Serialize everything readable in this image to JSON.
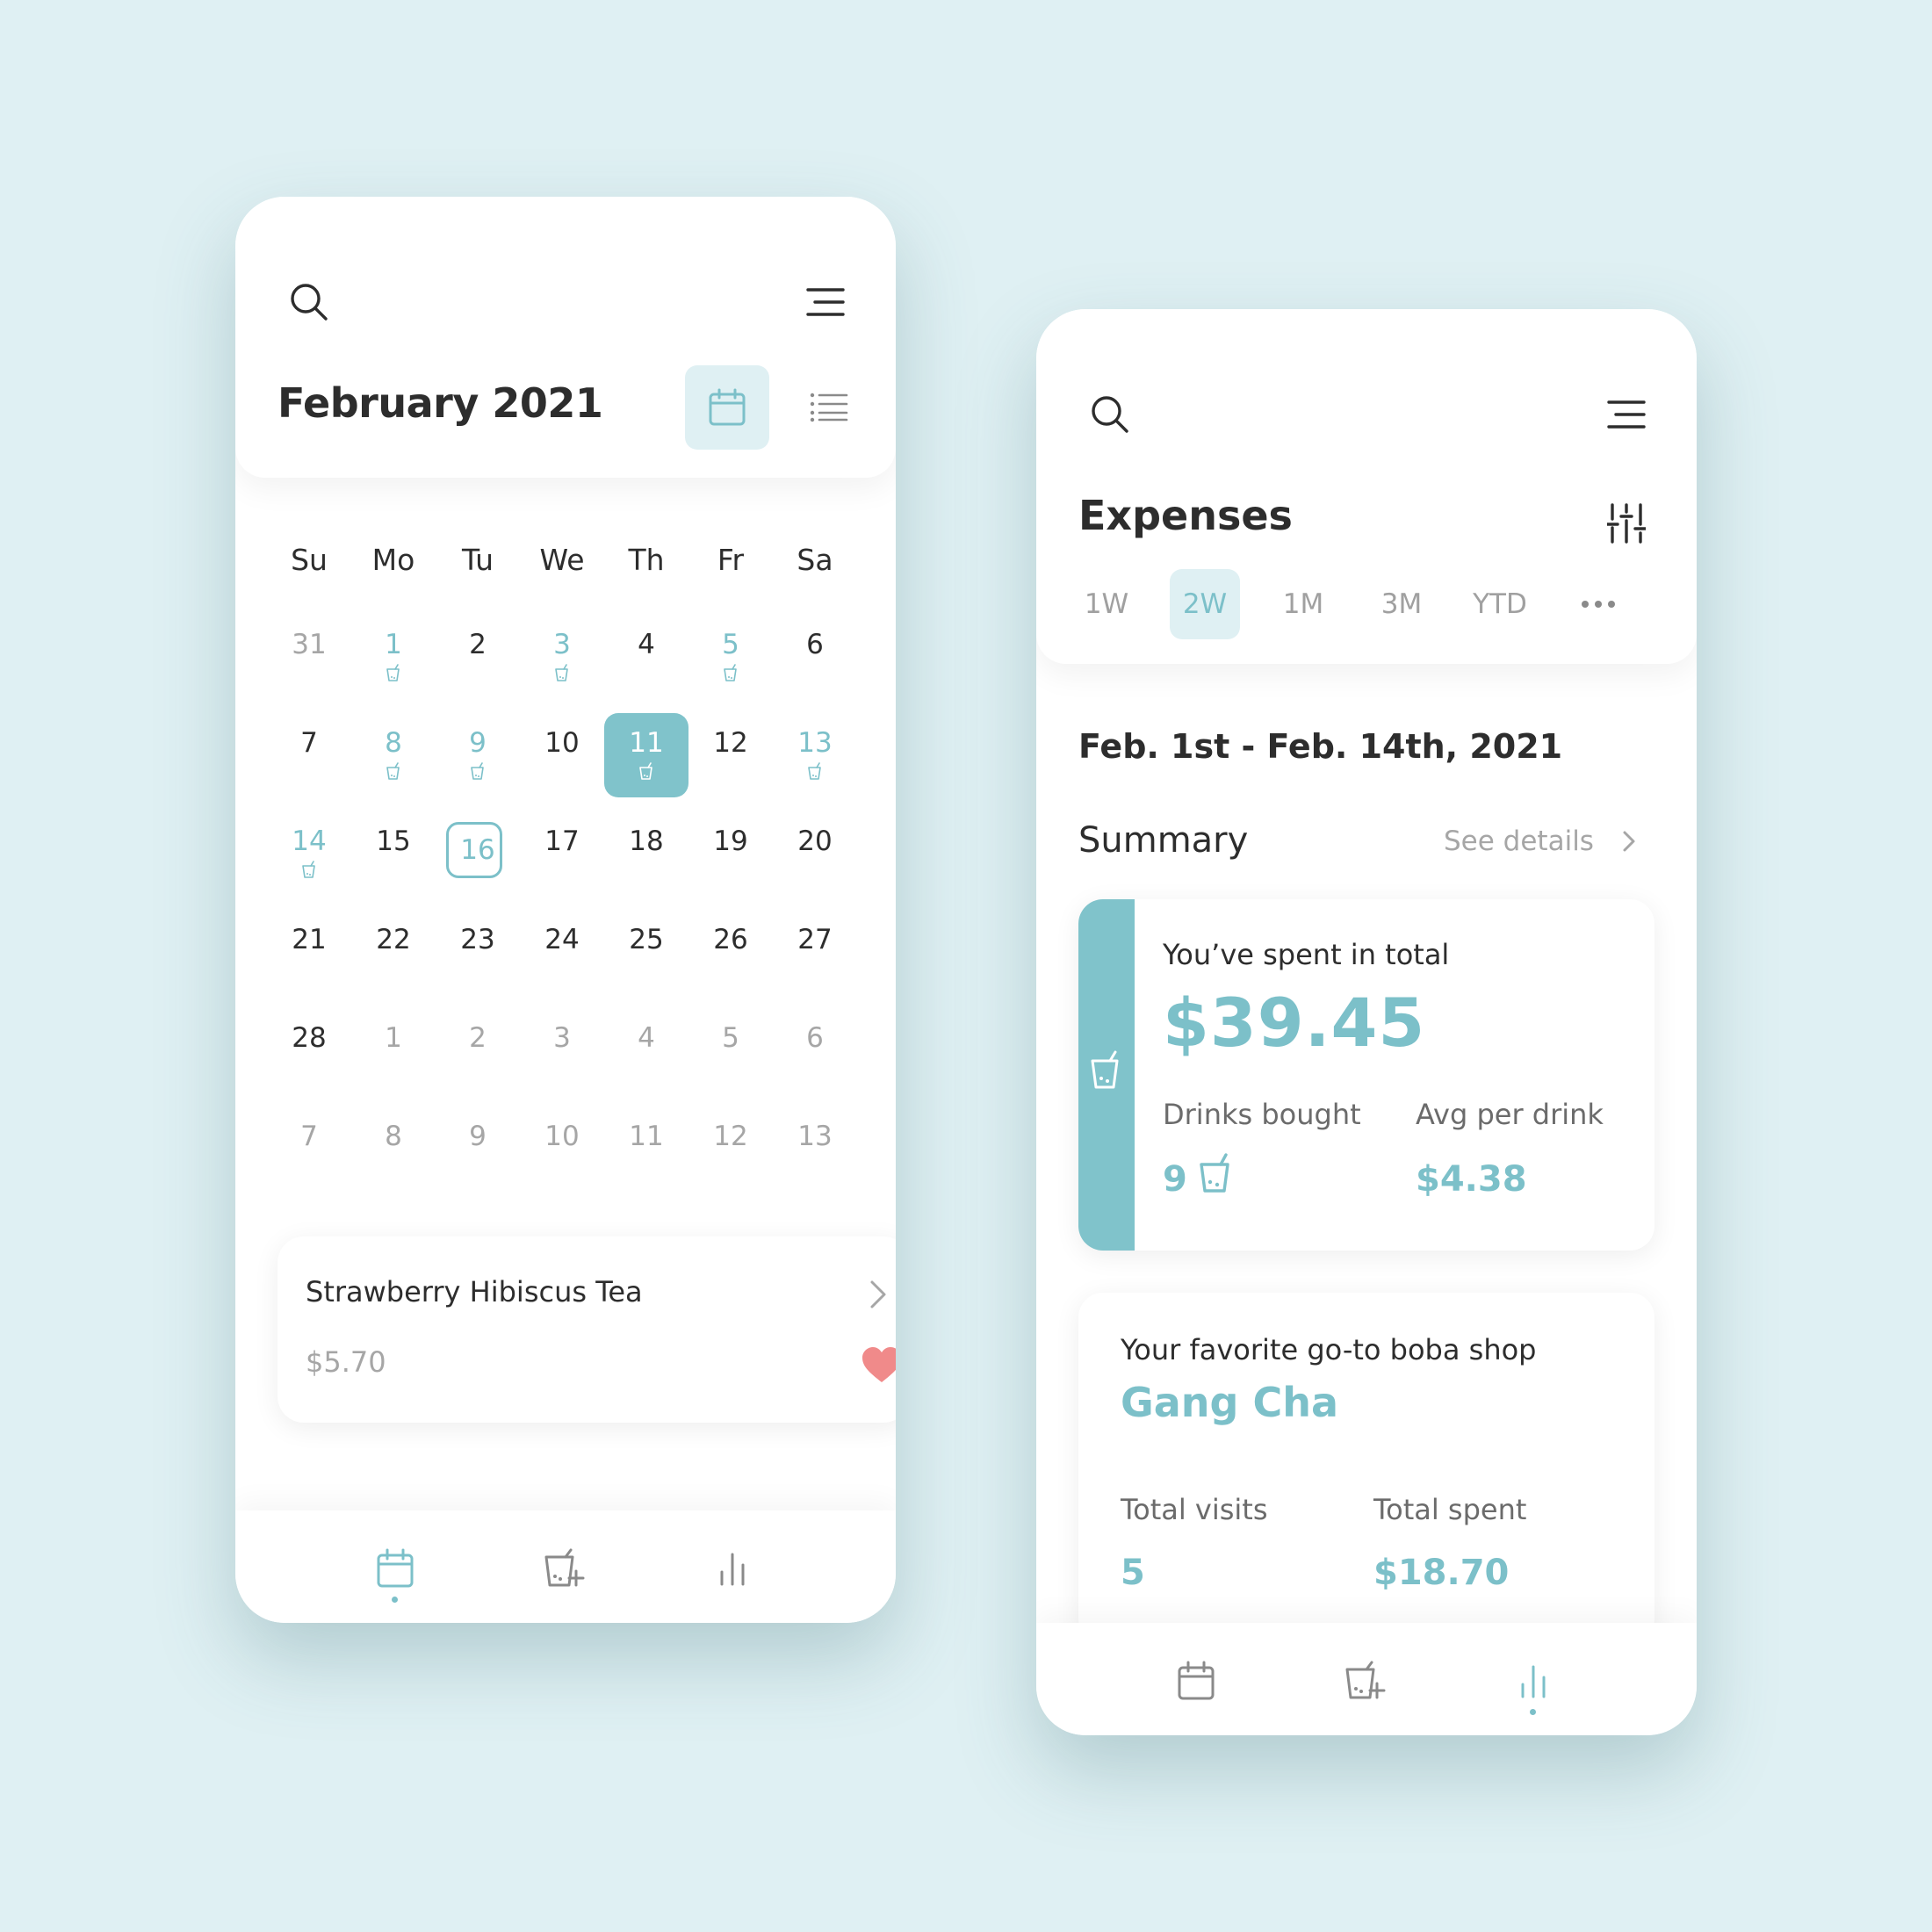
{
  "colors": {
    "background": "#dff0f3",
    "accent": "#7cc0c9",
    "accent_fill": "#80c3cb",
    "heart": "#f08a8a",
    "text_dark": "#2d2d2d",
    "text_muted": "#a6a6a6"
  },
  "calendar_screen": {
    "icons": {
      "search": "search-icon",
      "menu": "menu-icon",
      "calendar_view": "calendar-icon",
      "list_view": "list-icon"
    },
    "month_title": "February 2021",
    "weekdays": [
      "Su",
      "Mo",
      "Tu",
      "We",
      "Th",
      "Fr",
      "Sa"
    ],
    "days": [
      {
        "label": "31",
        "state": "muted",
        "drink": false
      },
      {
        "label": "1",
        "state": "drink",
        "drink": true
      },
      {
        "label": "2",
        "state": "normal",
        "drink": false
      },
      {
        "label": "3",
        "state": "drink",
        "drink": true
      },
      {
        "label": "4",
        "state": "normal",
        "drink": false
      },
      {
        "label": "5",
        "state": "drink",
        "drink": true
      },
      {
        "label": "6",
        "state": "normal",
        "drink": false
      },
      {
        "label": "7",
        "state": "normal",
        "drink": false
      },
      {
        "label": "8",
        "state": "drink",
        "drink": true
      },
      {
        "label": "9",
        "state": "drink",
        "drink": true
      },
      {
        "label": "10",
        "state": "normal",
        "drink": false
      },
      {
        "label": "11",
        "state": "selected",
        "drink": true
      },
      {
        "label": "12",
        "state": "normal",
        "drink": false
      },
      {
        "label": "13",
        "state": "drink",
        "drink": true
      },
      {
        "label": "14",
        "state": "drink",
        "drink": true
      },
      {
        "label": "15",
        "state": "normal",
        "drink": false
      },
      {
        "label": "16",
        "state": "today",
        "drink": false
      },
      {
        "label": "17",
        "state": "normal",
        "drink": false
      },
      {
        "label": "18",
        "state": "normal",
        "drink": false
      },
      {
        "label": "19",
        "state": "normal",
        "drink": false
      },
      {
        "label": "20",
        "state": "normal",
        "drink": false
      },
      {
        "label": "21",
        "state": "normal",
        "drink": false
      },
      {
        "label": "22",
        "state": "normal",
        "drink": false
      },
      {
        "label": "23",
        "state": "normal",
        "drink": false
      },
      {
        "label": "24",
        "state": "normal",
        "drink": false
      },
      {
        "label": "25",
        "state": "normal",
        "drink": false
      },
      {
        "label": "26",
        "state": "normal",
        "drink": false
      },
      {
        "label": "27",
        "state": "normal",
        "drink": false
      },
      {
        "label": "28",
        "state": "normal",
        "drink": false
      },
      {
        "label": "1",
        "state": "muted",
        "drink": false
      },
      {
        "label": "2",
        "state": "muted",
        "drink": false
      },
      {
        "label": "3",
        "state": "muted",
        "drink": false
      },
      {
        "label": "4",
        "state": "muted",
        "drink": false
      },
      {
        "label": "5",
        "state": "muted",
        "drink": false
      },
      {
        "label": "6",
        "state": "muted",
        "drink": false
      },
      {
        "label": "7",
        "state": "muted",
        "drink": false
      },
      {
        "label": "8",
        "state": "muted",
        "drink": false
      },
      {
        "label": "9",
        "state": "muted",
        "drink": false
      },
      {
        "label": "10",
        "state": "muted",
        "drink": false
      },
      {
        "label": "11",
        "state": "muted",
        "drink": false
      },
      {
        "label": "12",
        "state": "muted",
        "drink": false
      },
      {
        "label": "13",
        "state": "muted",
        "drink": false
      }
    ],
    "drink_card": {
      "name": "Strawberry Hibiscus Tea",
      "price": "$5.70",
      "favorite_icon": "heart-icon",
      "chevron_icon": "chevron-right-icon"
    },
    "bottom_nav": {
      "items": [
        "calendar-icon",
        "add-drink-icon",
        "stats-icon"
      ],
      "active_index": 0
    }
  },
  "expenses_screen": {
    "icons": {
      "search": "search-icon",
      "menu": "menu-icon",
      "filter": "filter-sliders-icon",
      "more": "more-dots-icon"
    },
    "title": "Expenses",
    "range_tabs": [
      "1W",
      "2W",
      "1M",
      "3M",
      "YTD"
    ],
    "active_range": "2W",
    "date_range": "Feb. 1st - Feb. 14th, 2021",
    "summary_label": "Summary",
    "see_details": "See details",
    "total_card": {
      "label": "You’ve spent in total",
      "value": "$39.45",
      "drinks_label": "Drinks bought",
      "drinks_value": "9",
      "avg_label": "Avg per drink",
      "avg_value": "$4.38"
    },
    "shop_card": {
      "label": "Your favorite go-to boba shop",
      "name": "Gang Cha",
      "visits_label": "Total visits",
      "visits_value": "5",
      "spent_label": "Total spent",
      "spent_value": "$18.70"
    },
    "bottom_nav": {
      "items": [
        "calendar-icon",
        "add-drink-icon",
        "stats-icon"
      ],
      "active_index": 2
    }
  }
}
